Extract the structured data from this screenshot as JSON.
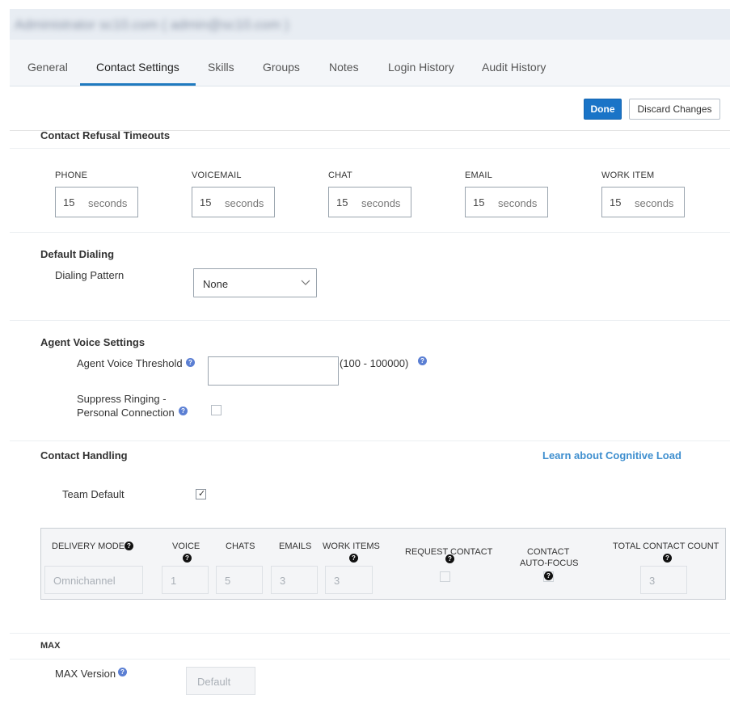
{
  "header": {
    "title": "Administrator sc10.com ( admin@sc10.com )"
  },
  "tabs": [
    {
      "label": "General"
    },
    {
      "label": "Contact Settings",
      "active": true
    },
    {
      "label": "Skills"
    },
    {
      "label": "Groups"
    },
    {
      "label": "Notes"
    },
    {
      "label": "Login History"
    },
    {
      "label": "Audit History"
    }
  ],
  "actions": {
    "done_label": "Done",
    "discard_label": "Discard Changes"
  },
  "refusal": {
    "title": "Contact Refusal Timeouts",
    "channels": [
      {
        "label": "PHONE",
        "value": "15",
        "unit": "seconds"
      },
      {
        "label": "VOICEMAIL",
        "value": "15",
        "unit": "seconds"
      },
      {
        "label": "CHAT",
        "value": "15",
        "unit": "seconds"
      },
      {
        "label": "EMAIL",
        "value": "15",
        "unit": "seconds"
      },
      {
        "label": "WORK ITEM",
        "value": "15",
        "unit": "seconds"
      }
    ]
  },
  "dialing": {
    "title": "Default Dialing",
    "pattern_label": "Dialing Pattern",
    "pattern_value": "None"
  },
  "voice": {
    "title": "Agent Voice Settings",
    "threshold_label": "Agent Voice Threshold",
    "threshold_value": "",
    "threshold_range": "(100 - 100000)",
    "suppress_label_line1": "Suppress Ringing -",
    "suppress_label_line2": "Personal Connection",
    "suppress_checked": false
  },
  "handling": {
    "title": "Contact Handling",
    "link": "Learn about Cognitive Load",
    "team_default_label": "Team Default",
    "team_default_checked": true,
    "headers": {
      "delivery_mode": "DELIVERY MODE",
      "voice": "VOICE",
      "chats": "CHATS",
      "emails": "EMAILS",
      "work_items": "WORK ITEMS",
      "request_contact": "REQUEST CONTACT",
      "auto_focus_line1": "CONTACT",
      "auto_focus_line2": "AUTO-FOCUS",
      "total": "TOTAL CONTACT COUNT"
    },
    "values": {
      "delivery_mode": "Omnichannel",
      "voice": "1",
      "chats": "5",
      "emails": "3",
      "work_items": "3",
      "total": "3"
    }
  },
  "max": {
    "title": "MAX",
    "version_label": "MAX Version",
    "version_value": "Default"
  },
  "icons": {
    "help": "?",
    "check": "✓"
  },
  "colors": {
    "accent": "#1a74c7",
    "link": "#3f8fcf",
    "tab_underline": "#1f7abf"
  }
}
